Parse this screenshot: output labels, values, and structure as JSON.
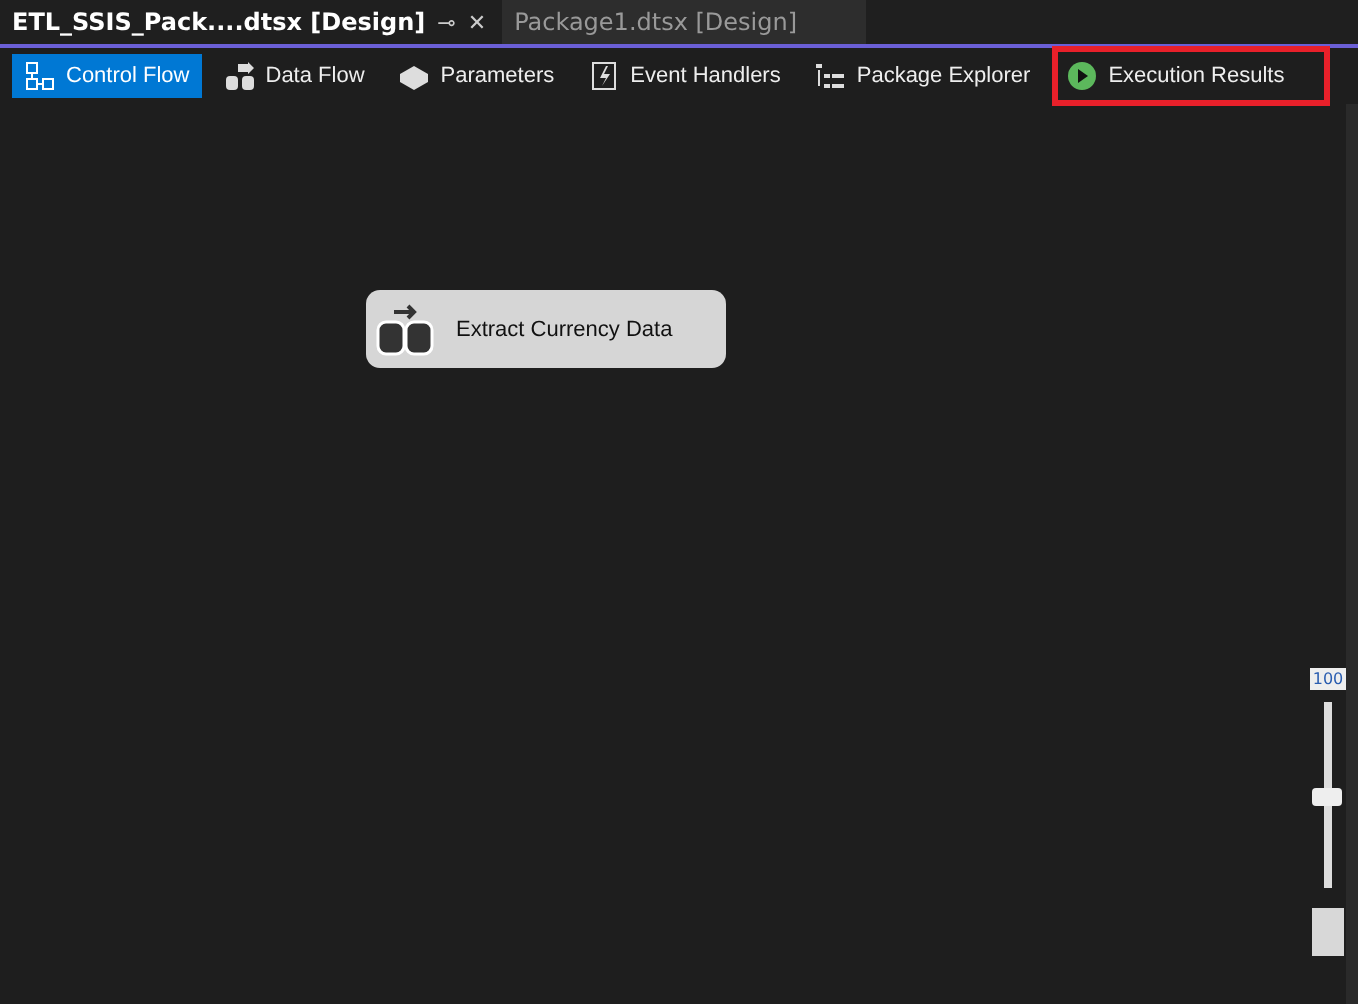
{
  "document_tabs": [
    {
      "label": "ETL_SSIS_Pack....dtsx [Design]",
      "selected": true,
      "pin": "⊸",
      "close": "✕"
    },
    {
      "label": "Package1.dtsx [Design]",
      "selected": false
    }
  ],
  "designer_tabs": [
    {
      "label": "Control Flow",
      "selected": true,
      "kind": "flow",
      "highlighted": false
    },
    {
      "label": "Data Flow",
      "selected": false,
      "kind": "dataflow",
      "highlighted": false
    },
    {
      "label": "Parameters",
      "selected": false,
      "kind": "params",
      "highlighted": false
    },
    {
      "label": "Event Handlers",
      "selected": false,
      "kind": "events",
      "highlighted": false
    },
    {
      "label": "Package Explorer",
      "selected": false,
      "kind": "explorer",
      "highlighted": false
    },
    {
      "label": "Execution Results",
      "selected": false,
      "kind": "results",
      "highlighted": true
    }
  ],
  "canvas": {
    "tasks": [
      {
        "label": "Extract Currency Data"
      }
    ],
    "zoom": {
      "reading": "100",
      "level": 0.48
    }
  }
}
